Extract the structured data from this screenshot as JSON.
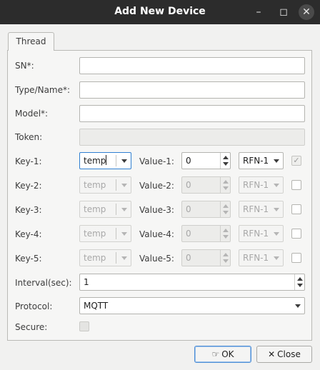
{
  "window": {
    "title": "Add New Device"
  },
  "tabs": [
    {
      "label": "Thread"
    }
  ],
  "form": {
    "sn": {
      "label": "SN*:",
      "value": ""
    },
    "type_name": {
      "label": "Type/Name*:",
      "value": ""
    },
    "model": {
      "label": "Model*:",
      "value": ""
    },
    "token": {
      "label": "Token:",
      "value": ""
    },
    "keys": [
      {
        "key_label": "Key-1:",
        "key_value": "temp",
        "value_label": "Value-1:",
        "value": "0",
        "format": "RFN-1",
        "enabled": true,
        "checked": true
      },
      {
        "key_label": "Key-2:",
        "key_value": "temp",
        "value_label": "Value-2:",
        "value": "0",
        "format": "RFN-1",
        "enabled": false,
        "checked": false
      },
      {
        "key_label": "Key-3:",
        "key_value": "temp",
        "value_label": "Value-3:",
        "value": "0",
        "format": "RFN-1",
        "enabled": false,
        "checked": false
      },
      {
        "key_label": "Key-4:",
        "key_value": "temp",
        "value_label": "Value-4:",
        "value": "0",
        "format": "RFN-1",
        "enabled": false,
        "checked": false
      },
      {
        "key_label": "Key-5:",
        "key_value": "temp",
        "value_label": "Value-5:",
        "value": "0",
        "format": "RFN-1",
        "enabled": false,
        "checked": false
      }
    ],
    "interval": {
      "label": "Interval(sec):",
      "value": "1"
    },
    "protocol": {
      "label": "Protocol:",
      "value": "MQTT"
    },
    "secure": {
      "label": "Secure:",
      "checked": false
    }
  },
  "buttons": {
    "ok": {
      "label": "OK",
      "icon": "hand-ok-icon"
    },
    "close": {
      "label": "Close",
      "icon": "x-close-icon"
    }
  },
  "icons": {
    "minimize": "minimize-icon",
    "maximize": "maximize-icon",
    "close": "window-close-icon"
  },
  "colors": {
    "titlebar": "#2c2c2c",
    "focus": "#2f7fd1",
    "default_button": "#4f8fd6"
  }
}
